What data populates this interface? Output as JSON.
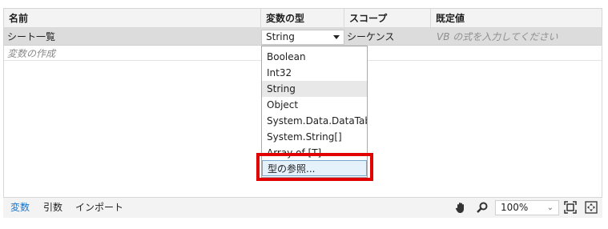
{
  "table": {
    "headers": {
      "name": "名前",
      "type": "変数の型",
      "scope": "スコープ",
      "default": "既定値"
    },
    "row": {
      "name": "シート一覧",
      "type": "String",
      "scope": "シーケンス",
      "default_placeholder": "VB の式を入力してください"
    },
    "create_row": "変数の作成"
  },
  "dropdown": {
    "items": [
      "Boolean",
      "Int32",
      "String",
      "Object",
      "System.Data.DataTable",
      "System.String[]",
      "Array of [T]",
      "型の参照..."
    ],
    "selected": "String"
  },
  "footer": {
    "tabs": [
      "変数",
      "引数",
      "インポート"
    ],
    "active_tab": "変数",
    "zoom": "100%",
    "icons": [
      "hand-icon",
      "search-icon",
      "zoom-chevron-icon",
      "fit-to-screen-icon",
      "overview-icon"
    ]
  },
  "colors": {
    "highlight": "#e00000",
    "active_tab": "#1a73c9"
  }
}
